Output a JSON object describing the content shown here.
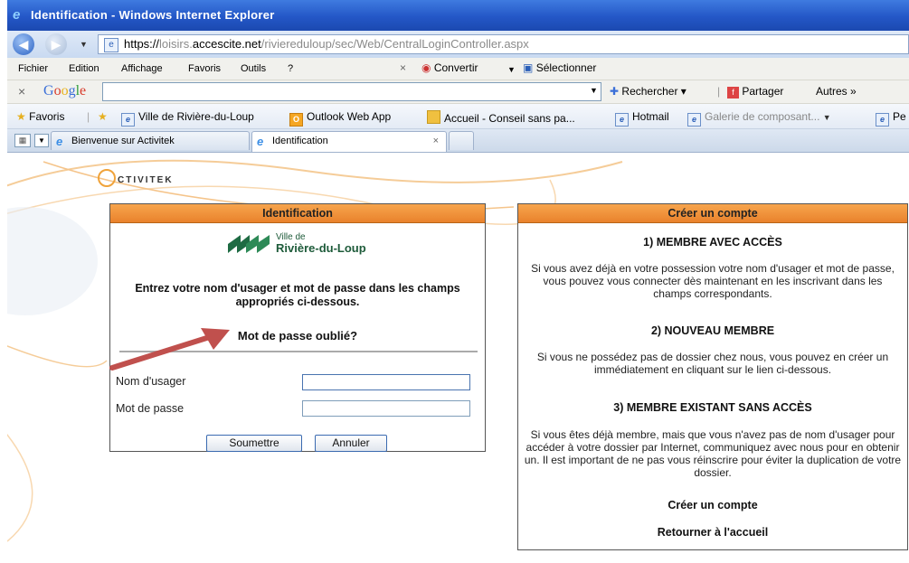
{
  "window": {
    "title": "Identification - Windows Internet Explorer"
  },
  "address": {
    "scheme": "https://",
    "host_dim": "loisirs.",
    "host": "accescite.net",
    "path": "/riviereduloup/sec/Web/CentralLoginController.aspx"
  },
  "menu": {
    "items": [
      "Fichier",
      "Edition",
      "Affichage",
      "Favoris",
      "Outils",
      "?"
    ],
    "close": "×",
    "convertir": "Convertir",
    "selectionner": "Sélectionner"
  },
  "google": {
    "close": "×",
    "logo": "Google",
    "search_value": "",
    "rechercher": "Rechercher",
    "partager": "Partager",
    "autres": "Autres »"
  },
  "favorites": {
    "label": "Favoris",
    "items": [
      "Ville de Rivière-du-Loup",
      "Outlook Web App",
      "Accueil - Conseil sans pa...",
      "Hotmail",
      "Galerie de composant...",
      "Pe"
    ]
  },
  "tabs": {
    "items": [
      "Bienvenue sur Activitek",
      "Identification"
    ],
    "close": "×"
  },
  "logo": {
    "text": "CTIVITEK"
  },
  "login": {
    "header": "Identification",
    "ville_small": "Ville de",
    "ville_big": "Rivière-du-Loup",
    "instructions": "Entrez votre nom d'usager et mot de passe dans les champs appropriés ci-dessous.",
    "forgot": "Mot de passe oublié?",
    "username_label": "Nom d'usager",
    "username_value": "",
    "password_label": "Mot de passe",
    "password_value": "",
    "submit": "Soumettre",
    "cancel": "Annuler"
  },
  "account": {
    "header": "Créer un compte",
    "s1_title": "1) MEMBRE AVEC ACCÈS",
    "s1_text": "Si vous avez déjà en votre possession votre nom d'usager et mot de passe, vous pouvez vous connecter dès maintenant en les inscrivant dans les champs correspondants.",
    "s2_title": "2) NOUVEAU MEMBRE",
    "s2_text": "Si vous ne possédez pas de dossier chez nous, vous pouvez en créer un immédiatement en cliquant sur le lien ci-dessous.",
    "s3_title": "3) MEMBRE EXISTANT SANS ACCÈS",
    "s3_text": "Si vous êtes déjà membre, mais que vous n'avez pas de nom d'usager pour accéder à votre dossier par Internet, communiquez avec nous pour en obtenir un. Il est important de ne pas vous réinscrire pour éviter la duplication de votre dossier.",
    "create_link": "Créer un compte",
    "home_link": "Retourner à l'accueil"
  },
  "colors": {
    "titlebar": "#2457c7",
    "panel_header": "#f29a45",
    "arrow": "#c0504d",
    "swirl": "#f5c48a"
  }
}
